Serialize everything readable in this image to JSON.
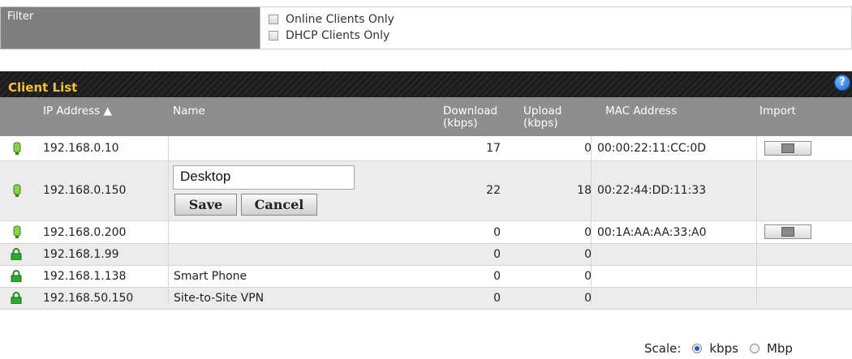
{
  "filter": {
    "label": "Filter",
    "options": [
      {
        "label": "Online Clients Only",
        "checked": false
      },
      {
        "label": "DHCP Clients Only",
        "checked": false
      }
    ]
  },
  "client_list": {
    "title": "Client List",
    "help_icon": "?",
    "columns": {
      "ip": "IP Address ▲",
      "name": "Name",
      "download_1": "Download",
      "download_2": "(kbps)",
      "upload_1": "Upload",
      "upload_2": "(kbps)",
      "mac": "MAC Address",
      "import": "Import"
    },
    "rows": [
      {
        "icon": "online-icon",
        "ip": "192.168.0.10",
        "name": "",
        "download": "17",
        "upload": "0",
        "mac": "00:00:22:11:CC:0D",
        "import": true
      },
      {
        "icon": "online-icon",
        "ip": "192.168.0.150",
        "name_input": "Desktop",
        "save": "Save",
        "cancel": "Cancel",
        "download": "22",
        "upload": "18",
        "mac": "00:22:44:DD:11:33",
        "import": false
      },
      {
        "icon": "online-icon",
        "ip": "192.168.0.200",
        "name": "",
        "download": "0",
        "upload": "0",
        "mac": "00:1A:AA:AA:33:A0",
        "import": true
      },
      {
        "icon": "lock-icon",
        "ip": "192.168.1.99",
        "name": "",
        "download": "0",
        "upload": "0",
        "mac": "",
        "import": false
      },
      {
        "icon": "lock-icon",
        "ip": "192.168.1.138",
        "name": "Smart Phone",
        "download": "0",
        "upload": "0",
        "mac": "",
        "import": false
      },
      {
        "icon": "lock-icon",
        "ip": "192.168.50.150",
        "name": "Site-to-Site VPN",
        "download": "0",
        "upload": "0",
        "mac": "",
        "import": false
      }
    ]
  },
  "scale": {
    "label": "Scale:",
    "options": [
      {
        "label": "kbps",
        "selected": true
      },
      {
        "label": "Mbp",
        "selected": false
      }
    ]
  }
}
